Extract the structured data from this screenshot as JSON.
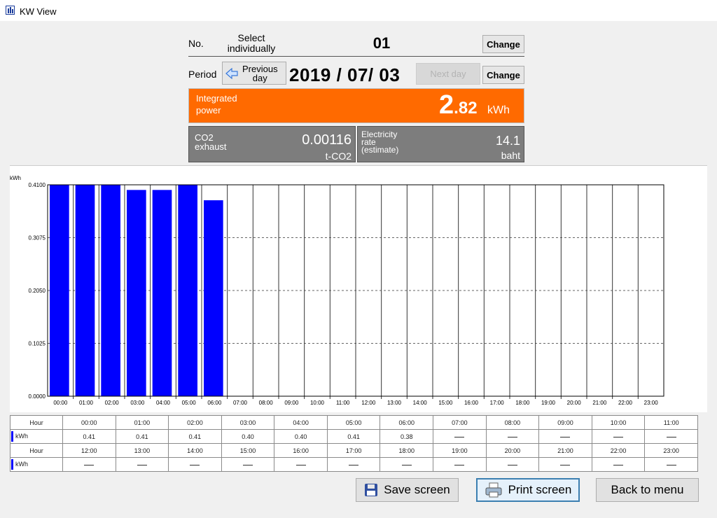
{
  "window": {
    "title": "KW View",
    "icon": "bar-chart-icon"
  },
  "header": {
    "no_label": "No.",
    "select_label_1": "Select",
    "select_label_2": "individually",
    "number": "01",
    "change_label": "Change",
    "period_label": "Period",
    "prev_day_1": "Previous",
    "prev_day_2": "day",
    "date": "2019 / 07/ 03",
    "next_day": "Next day",
    "change2_label": "Change"
  },
  "integrated": {
    "label_1": "Integrated",
    "label_2": "power",
    "value_int": "2",
    "value_dec": ".82",
    "unit": "kWh"
  },
  "co2": {
    "label_1": "CO2",
    "label_2": "exhaust",
    "value": "0.00116",
    "unit": "t-CO2"
  },
  "rate": {
    "label_1": "Electricity",
    "label_2": "rate",
    "label_3": "(estimate)",
    "value": "14.1",
    "unit": "baht"
  },
  "chart_data": {
    "type": "bar",
    "ylabel": "kWh",
    "ylim": [
      0,
      0.41
    ],
    "y_ticks": [
      "0.4100",
      "0.3075",
      "0.2050",
      "0.1025",
      "0.0000"
    ],
    "categories": [
      "00:00",
      "01:00",
      "02:00",
      "03:00",
      "04:00",
      "05:00",
      "06:00",
      "07:00",
      "08:00",
      "09:00",
      "10:00",
      "11:00",
      "12:00",
      "13:00",
      "14:00",
      "15:00",
      "16:00",
      "17:00",
      "18:00",
      "19:00",
      "20:00",
      "21:00",
      "22:00",
      "23:00"
    ],
    "values": [
      0.41,
      0.41,
      0.41,
      0.4,
      0.4,
      0.41,
      0.38,
      null,
      null,
      null,
      null,
      null,
      null,
      null,
      null,
      null,
      null,
      null,
      null,
      null,
      null,
      null,
      null,
      null
    ],
    "bar_color": "#0000ff",
    "grid": "dashed horizontal"
  },
  "table": {
    "hour_label": "Hour",
    "kwh_label": "kWh",
    "row1_hours": [
      "00:00",
      "01:00",
      "02:00",
      "03:00",
      "04:00",
      "05:00",
      "06:00",
      "07:00",
      "08:00",
      "09:00",
      "10:00",
      "11:00"
    ],
    "row1_values": [
      "0.41",
      "0.41",
      "0.41",
      "0.40",
      "0.40",
      "0.41",
      "0.38",
      "",
      "",
      "",
      "",
      ""
    ],
    "row2_hours": [
      "12:00",
      "13:00",
      "14:00",
      "15:00",
      "16:00",
      "17:00",
      "18:00",
      "19:00",
      "20:00",
      "21:00",
      "22:00",
      "23:00"
    ],
    "row2_values": [
      "",
      "",
      "",
      "",
      "",
      "",
      "",
      "",
      "",
      "",
      "",
      ""
    ]
  },
  "footer": {
    "save": "Save screen",
    "print": "Print screen",
    "back": "Back to menu"
  },
  "colors": {
    "accent": "#ff6a00",
    "panel_gray": "#7d7d7d",
    "bar": "#0000ff"
  }
}
